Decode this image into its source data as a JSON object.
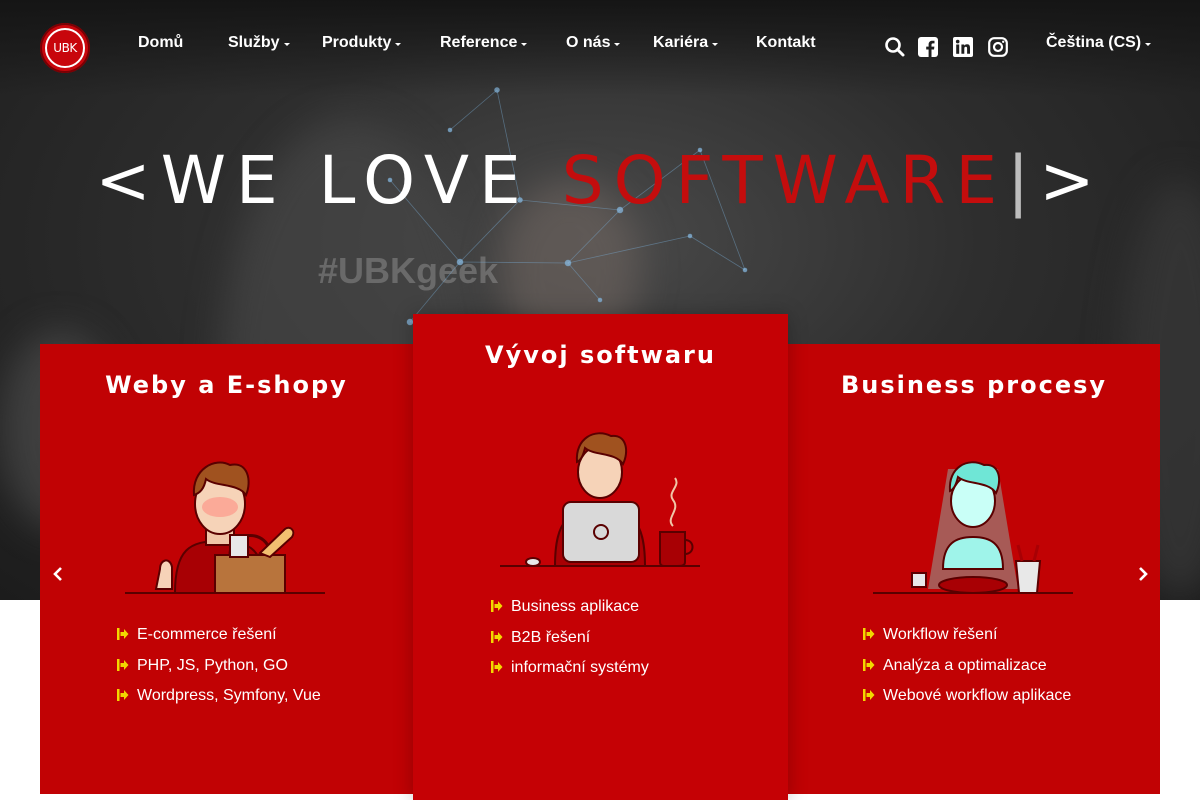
{
  "brand": {
    "logo_text": "UBK"
  },
  "nav": {
    "items": [
      {
        "label": "Domů",
        "has_dropdown": false
      },
      {
        "label": "Služby",
        "has_dropdown": true
      },
      {
        "label": "Produkty",
        "has_dropdown": true
      },
      {
        "label": "Reference",
        "has_dropdown": true
      },
      {
        "label": "O nás",
        "has_dropdown": true
      },
      {
        "label": "Kariéra",
        "has_dropdown": true
      },
      {
        "label": "Kontakt",
        "has_dropdown": false
      }
    ],
    "icons": [
      "search-icon",
      "facebook-icon",
      "linkedin-icon",
      "instagram-icon"
    ],
    "language": "Čeština (CS)"
  },
  "hero": {
    "open": "<",
    "lead": "WE LOVE ",
    "highlight": "SOFTWARE",
    "cursor": "|",
    "close": ">",
    "background_text": "#UBKgeek"
  },
  "cards": [
    {
      "title": "Weby a E-shopy",
      "features": [
        "E-commerce řešení",
        "PHP, JS, Python, GO",
        "Wordpress, Symfony, Vue"
      ]
    },
    {
      "title": "Vývoj softwaru",
      "features": [
        "Business aplikace",
        "B2B řešení",
        "informační systémy"
      ]
    },
    {
      "title": "Business procesy",
      "features": [
        "Workflow řešení",
        "Analýza a optimalizace",
        "Webové workflow aplikace"
      ]
    }
  ],
  "carousel": {
    "prev_icon": "chevron-left-icon",
    "next_icon": "chevron-right-icon"
  },
  "colors": {
    "brand_red": "#c10204",
    "headline_red": "#c40d0d",
    "bullet_yellow": "#f2d800",
    "hero_dark": "#2e2e2e"
  }
}
